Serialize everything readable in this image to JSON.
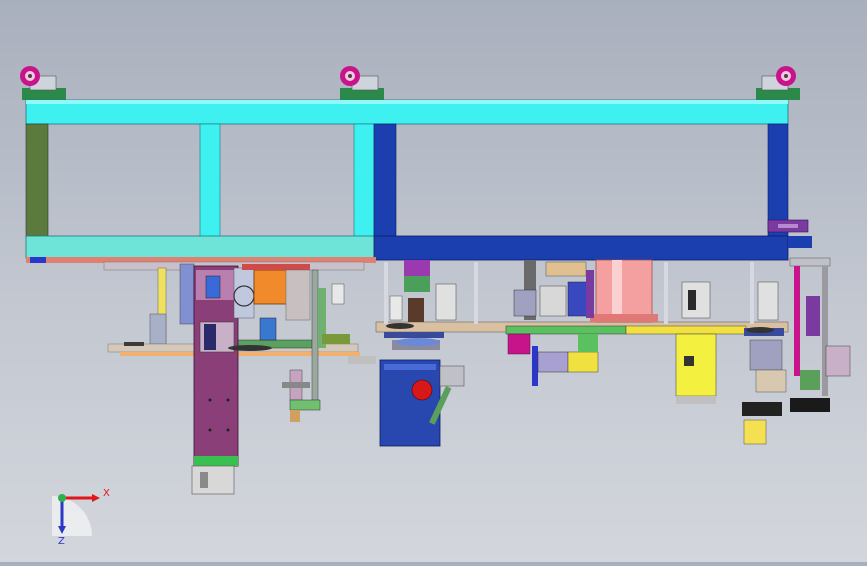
{
  "viewport": {
    "background_top": "#a9b0bd",
    "background_bottom": "#d3d6dc"
  },
  "triad": {
    "x_label": "X",
    "z_label": "Z",
    "x_color": "#e0161b",
    "y_color": "#2bb24a",
    "z_color": "#2c36c8"
  },
  "colors": {
    "frame_cyan": "#3ef0f0",
    "frame_navy": "#1c3fb0",
    "frame_olive": "#5a7a3e",
    "caster_magenta": "#c8148a",
    "orange_box": "#f08a2a",
    "plum_plate": "#8a3f78",
    "motor_blue": "#2848b0",
    "motor_red": "#d81818",
    "salmon_cylinder": "#f4a0a0",
    "yellow_box": "#f4f040",
    "purple_bracket": "#7a3aa0"
  }
}
